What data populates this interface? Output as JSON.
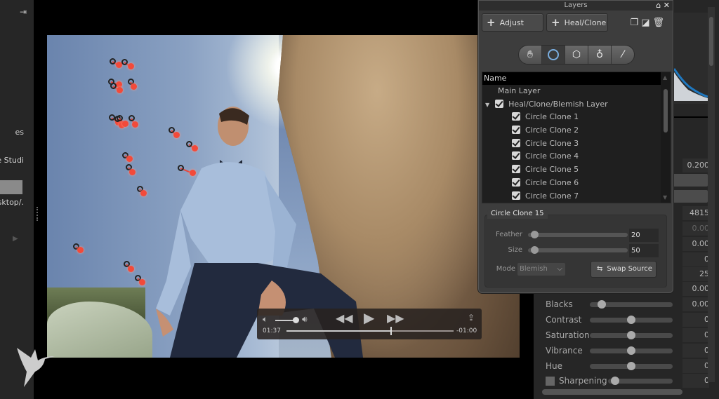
{
  "left_panel": {
    "items": [
      "es",
      "e Studi",
      "sktop/."
    ]
  },
  "video": {
    "elapsed": "01:37",
    "remaining": "-01:00",
    "progress": 0.62,
    "volume": 0.8
  },
  "layers": {
    "title": "Layers",
    "adjust_label": "Adjust",
    "heal_clone_label": "Heal/Clone",
    "tools": [
      "hand",
      "circle",
      "polygon",
      "freeform",
      "brush"
    ],
    "active_tool": "circle",
    "tree_header": "Name",
    "main_layer": "Main Layer",
    "group_layer": "Heal/Clone/Blemish Layer",
    "items": [
      "Circle Clone 1",
      "Circle Clone 2",
      "Circle Clone 3",
      "Circle Clone 4",
      "Circle Clone 5",
      "Circle Clone 6",
      "Circle Clone 7"
    ],
    "selected": {
      "title": "Circle Clone 15",
      "feather_label": "Feather",
      "feather": "20",
      "feather_frac": 0.03,
      "size_label": "Size",
      "size": "50",
      "size_frac": 0.03,
      "mode_label": "Mode",
      "mode": "Blemish",
      "swap_label": "Swap Source"
    }
  },
  "right_panel": {
    "values": [
      "0.200",
      "4815",
      "0.00",
      "0.00",
      "0",
      "25",
      "0.00",
      "0.00",
      "0",
      "0",
      "0",
      "0",
      "0"
    ],
    "sliders": [
      {
        "label": "Blacks",
        "value": 0.1
      },
      {
        "label": "Contrast",
        "value": 0.5
      },
      {
        "label": "Saturation",
        "value": 0.5
      },
      {
        "label": "Vibrance",
        "value": 0.5
      },
      {
        "label": "Hue",
        "value": 0.5
      },
      {
        "label": "Sharpening",
        "value": 0.05
      }
    ]
  }
}
